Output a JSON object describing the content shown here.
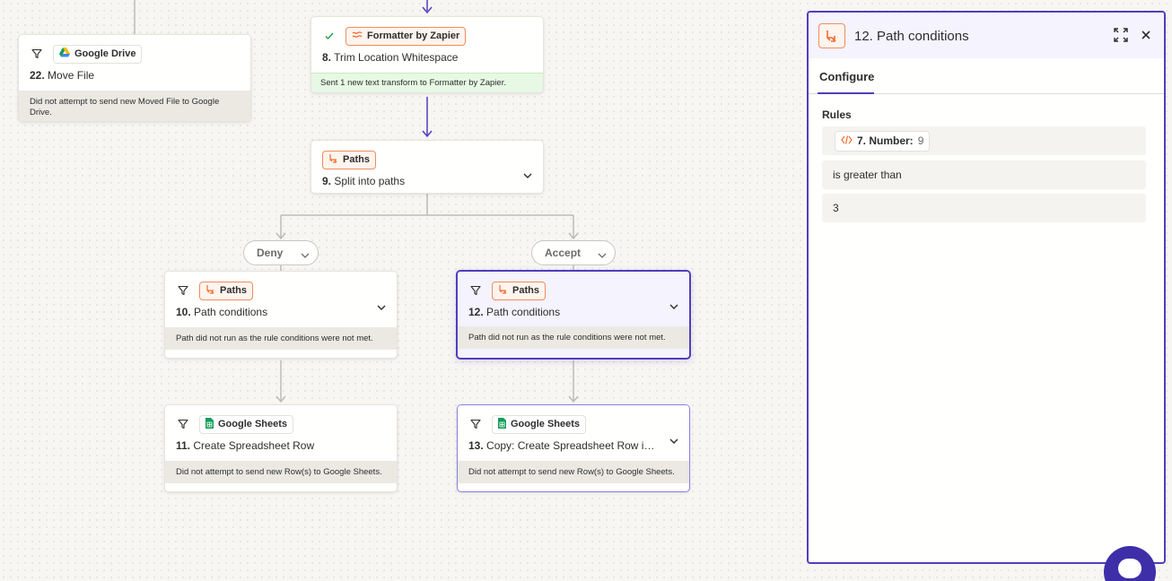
{
  "canvas": {
    "steps": {
      "move_file": {
        "app": "Google Drive",
        "number": "22.",
        "title": "Move File",
        "footer": "Did not attempt to send new Moved File to Google Drive."
      },
      "trim": {
        "app": "Formatter by Zapier",
        "number": "8.",
        "title": "Trim Location Whitespace",
        "footer": "Sent 1 new text transform to Formatter by Zapier."
      },
      "split": {
        "app": "Paths",
        "number": "9.",
        "title": "Split into paths"
      },
      "path10": {
        "app": "Paths",
        "number": "10.",
        "title": "Path conditions",
        "footer": "Path did not run as the rule conditions were not met."
      },
      "path12": {
        "app": "Paths",
        "number": "12.",
        "title": "Path conditions",
        "footer": "Path did not run as the rule conditions were not met."
      },
      "sheet11": {
        "app": "Google Sheets",
        "number": "11.",
        "title": "Create Spreadsheet Row",
        "footer": "Did not attempt to send new Row(s) to Google Sheets."
      },
      "sheet13": {
        "app": "Google Sheets",
        "number": "13.",
        "title": "Copy: Create Spreadsheet Row in...",
        "footer": "Did not attempt to send new Row(s) to Google Sheets."
      }
    },
    "branches": {
      "deny": "Deny",
      "accept": "Accept"
    }
  },
  "panel": {
    "title": "12. Path conditions",
    "tab": "Configure",
    "rules_label": "Rules",
    "rule_field_name": "7. Number:",
    "rule_field_value": "9",
    "rule_operator": "is greater than",
    "rule_value": "3"
  },
  "colors": {
    "accent": "#503ebd",
    "paths_orange": "#f26b2b",
    "success_green": "#e7f8e4"
  }
}
